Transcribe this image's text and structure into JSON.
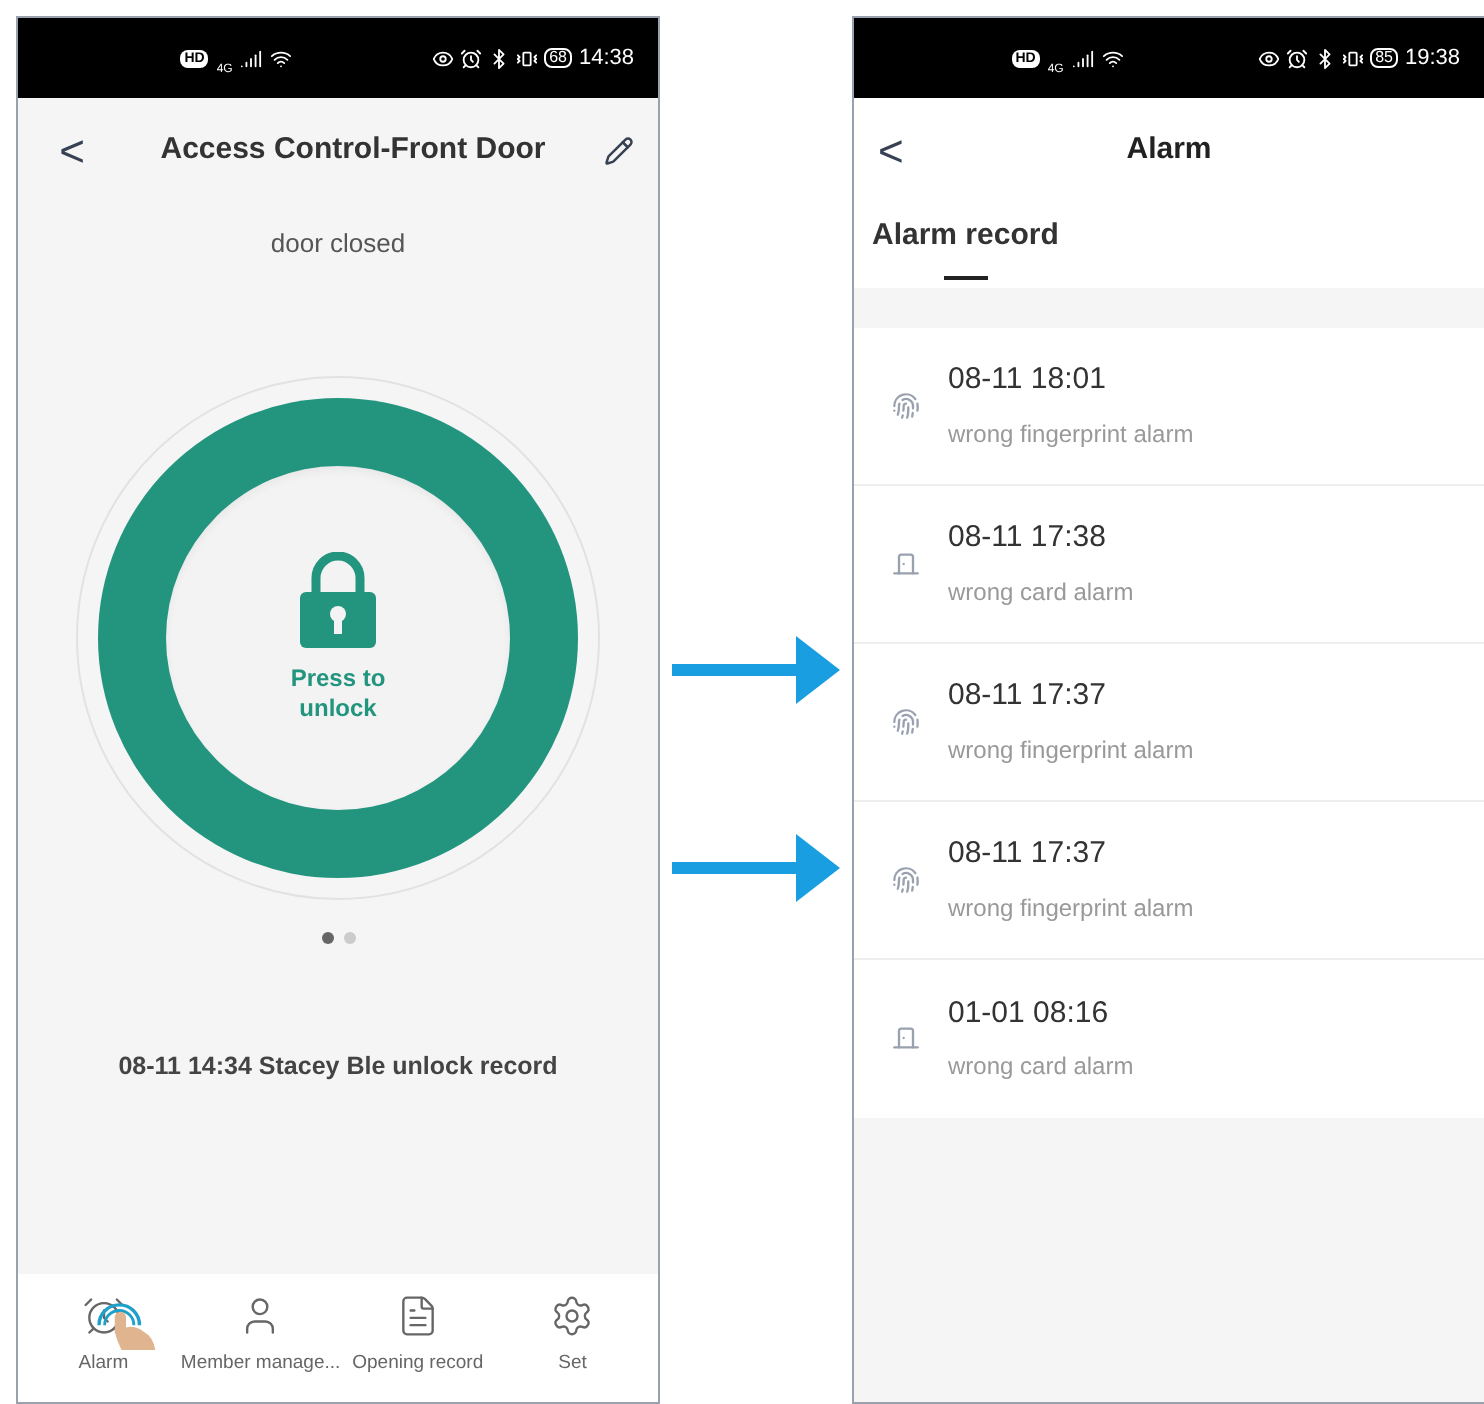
{
  "left_phone": {
    "status_bar": {
      "hd": "HD",
      "network": "4G",
      "battery": "68",
      "time": "14:38"
    },
    "header": {
      "back": "<",
      "title": "Access Control-Front Door"
    },
    "door_status": "door closed",
    "unlock_button": {
      "label": "Press to unlock"
    },
    "pager": [
      {
        "selected": true
      },
      {
        "selected": false
      }
    ],
    "last_record": "08-11 14:34 Stacey Ble unlock record",
    "nav": [
      {
        "kind": "alarm",
        "label": "Alarm"
      },
      {
        "kind": "member",
        "label": "Member manage..."
      },
      {
        "kind": "record",
        "label": "Opening record"
      },
      {
        "kind": "settings",
        "label": "Set"
      }
    ]
  },
  "right_phone": {
    "status_bar": {
      "hd": "HD",
      "network": "4G",
      "battery": "85",
      "time": "19:38"
    },
    "header": {
      "back": "<",
      "title": "Alarm"
    },
    "tab": {
      "label": "Alarm record",
      "selected": true
    },
    "alarms": [
      {
        "kind": "fingerprint",
        "time": "08-11 18:01",
        "text": "wrong fingerprint alarm"
      },
      {
        "kind": "card",
        "time": "08-11 17:38",
        "text": "wrong card alarm"
      },
      {
        "kind": "fingerprint",
        "time": "08-11 17:37",
        "text": "wrong fingerprint alarm"
      },
      {
        "kind": "fingerprint",
        "time": "08-11 17:37",
        "text": "wrong fingerprint alarm"
      },
      {
        "kind": "card",
        "time": "01-01 08:16",
        "text": "wrong card alarm"
      }
    ]
  }
}
